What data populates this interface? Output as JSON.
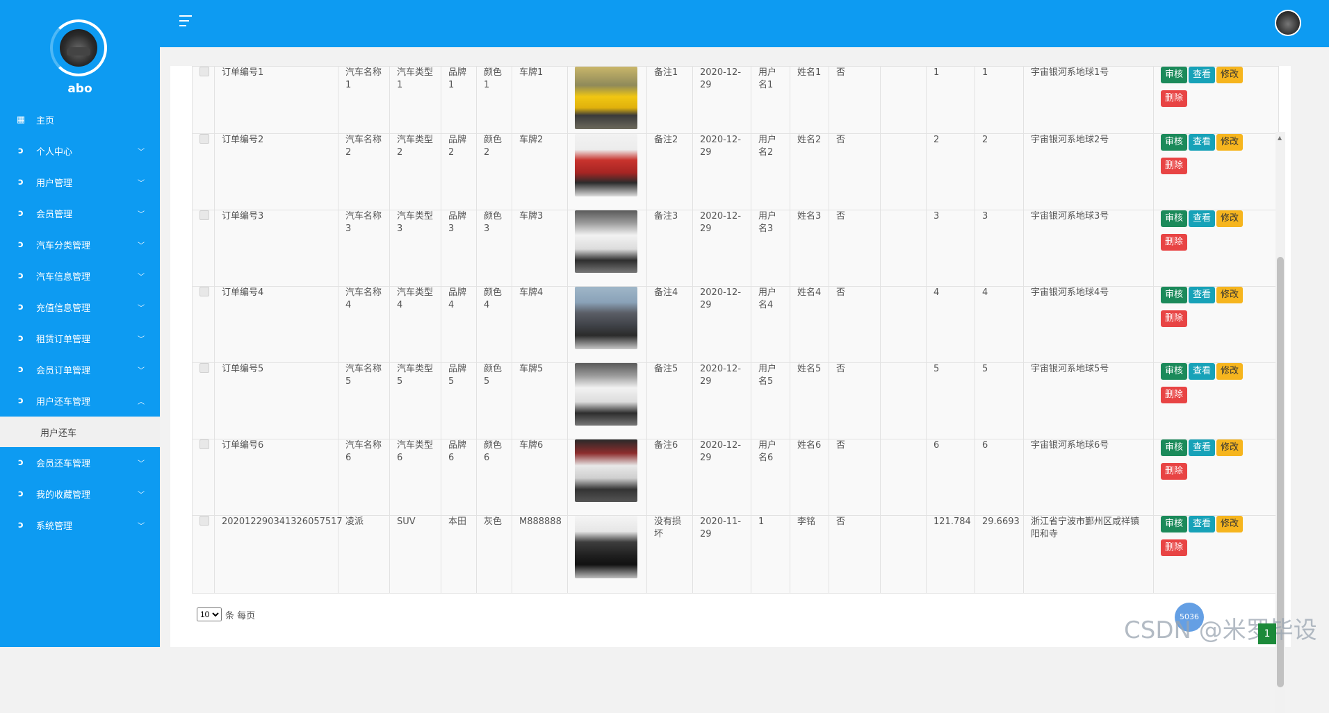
{
  "sidebar": {
    "username": "abo",
    "menu": [
      {
        "label": "主页",
        "icon": "dashboard-icon",
        "expandable": false
      },
      {
        "label": "个人中心",
        "icon": "stethoscope-icon",
        "expandable": true
      },
      {
        "label": "用户管理",
        "icon": "stethoscope-icon",
        "expandable": true
      },
      {
        "label": "会员管理",
        "icon": "stethoscope-icon",
        "expandable": true
      },
      {
        "label": "汽车分类管理",
        "icon": "stethoscope-icon",
        "expandable": true
      },
      {
        "label": "汽车信息管理",
        "icon": "stethoscope-icon",
        "expandable": true
      },
      {
        "label": "充值信息管理",
        "icon": "stethoscope-icon",
        "expandable": true
      },
      {
        "label": "租赁订单管理",
        "icon": "stethoscope-icon",
        "expandable": true
      },
      {
        "label": "会员订单管理",
        "icon": "stethoscope-icon",
        "expandable": true
      },
      {
        "label": "用户还车管理",
        "icon": "stethoscope-icon",
        "expandable": true,
        "expanded": true
      },
      {
        "label": "会员还车管理",
        "icon": "stethoscope-icon",
        "expandable": true
      },
      {
        "label": "我的收藏管理",
        "icon": "stethoscope-icon",
        "expandable": true
      },
      {
        "label": "系统管理",
        "icon": "stethoscope-icon",
        "expandable": true
      }
    ],
    "submenu_label": "用户还车"
  },
  "table": {
    "rows": [
      {
        "order": "订单编号1",
        "name": "汽车名称1",
        "type": "汽车类型1",
        "brand": "品牌1",
        "color": "颜色1",
        "plate": "车牌1",
        "image": "yellow",
        "remark": "备注1",
        "date": "2020-12-29",
        "user": "用户名1",
        "real_name": "姓名1",
        "flag": "否",
        "blank": "",
        "v1": "1",
        "v2": "1",
        "addr": "宇宙银河系地球1号"
      },
      {
        "order": "订单编号2",
        "name": "汽车名称2",
        "type": "汽车类型2",
        "brand": "品牌2",
        "color": "颜色2",
        "plate": "车牌2",
        "image": "red",
        "remark": "备注2",
        "date": "2020-12-29",
        "user": "用户名2",
        "real_name": "姓名2",
        "flag": "否",
        "blank": "",
        "v1": "2",
        "v2": "2",
        "addr": "宇宙银河系地球2号"
      },
      {
        "order": "订单编号3",
        "name": "汽车名称3",
        "type": "汽车类型3",
        "brand": "品牌3",
        "color": "颜色3",
        "plate": "车牌3",
        "image": "white",
        "remark": "备注3",
        "date": "2020-12-29",
        "user": "用户名3",
        "real_name": "姓名3",
        "flag": "否",
        "blank": "",
        "v1": "3",
        "v2": "3",
        "addr": "宇宙银河系地球3号"
      },
      {
        "order": "订单编号4",
        "name": "汽车名称4",
        "type": "汽车类型4",
        "brand": "品牌4",
        "color": "颜色4",
        "plate": "车牌4",
        "image": "grey",
        "remark": "备注4",
        "date": "2020-12-29",
        "user": "用户名4",
        "real_name": "姓名4",
        "flag": "否",
        "blank": "",
        "v1": "4",
        "v2": "4",
        "addr": "宇宙银河系地球4号"
      },
      {
        "order": "订单编号5",
        "name": "汽车名称5",
        "type": "汽车类型5",
        "brand": "品牌5",
        "color": "颜色5",
        "plate": "车牌5",
        "image": "white",
        "remark": "备注5",
        "date": "2020-12-29",
        "user": "用户名5",
        "real_name": "姓名5",
        "flag": "否",
        "blank": "",
        "v1": "5",
        "v2": "5",
        "addr": "宇宙银河系地球5号"
      },
      {
        "order": "订单编号6",
        "name": "汽车名称6",
        "type": "汽车类型6",
        "brand": "品牌6",
        "color": "颜色6",
        "plate": "车牌6",
        "image": "silver",
        "remark": "备注6",
        "date": "2020-12-29",
        "user": "用户名6",
        "real_name": "姓名6",
        "flag": "否",
        "blank": "",
        "v1": "6",
        "v2": "6",
        "addr": "宇宙银河系地球6号"
      },
      {
        "order": "202012290341326057517",
        "name": "凌派",
        "type": "SUV",
        "brand": "本田",
        "color": "灰色",
        "plate": "M888888",
        "image": "black",
        "remark": "没有损坏",
        "date": "2020-11-29",
        "user": "1",
        "real_name": "李铭",
        "flag": "否",
        "blank": "",
        "v1": "121.784",
        "v2": "29.6693",
        "addr": "浙江省宁波市鄞州区咸祥镇阳和寺"
      }
    ],
    "actions": {
      "audit": "审核",
      "view": "查看",
      "edit": "修改",
      "delete": "删除"
    }
  },
  "pager": {
    "page_size": "10",
    "suffix": "条 每页"
  },
  "overlay": {
    "watermark": "CSDN @米罗毕设",
    "help_text": "5036",
    "page_badge": "1"
  },
  "colors": {
    "primary": "#0d9bf2",
    "audit": "#1b8a5a",
    "view": "#17a2b8",
    "edit": "#f6b51e",
    "delete": "#e84444"
  }
}
